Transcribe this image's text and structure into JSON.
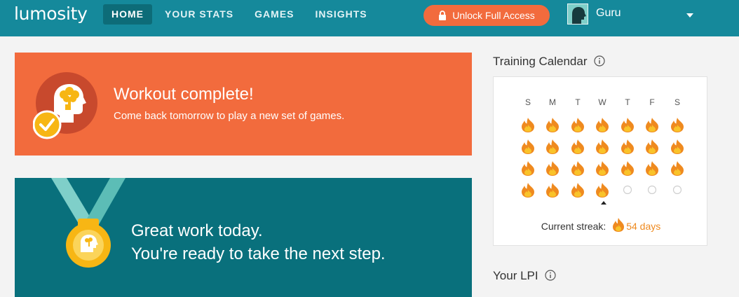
{
  "app": {
    "logo_text": "lumosity"
  },
  "nav": {
    "items": [
      {
        "label": "HOME",
        "active": true
      },
      {
        "label": "YOUR STATS",
        "active": false
      },
      {
        "label": "GAMES",
        "active": false
      },
      {
        "label": "INSIGHTS",
        "active": false
      }
    ]
  },
  "header": {
    "unlock_label": "Unlock Full Access",
    "username": "Guru"
  },
  "workout_card": {
    "title": "Workout complete!",
    "subtitle": "Come back tomorrow to play a new set of games."
  },
  "great_work_card": {
    "line1": "Great work today.",
    "line2": "You're ready to take the next step."
  },
  "training_calendar": {
    "title": "Training Calendar",
    "weekdays": [
      "S",
      "M",
      "T",
      "W",
      "T",
      "F",
      "S"
    ],
    "weeks": [
      [
        "trained",
        "trained",
        "trained",
        "trained",
        "trained",
        "trained",
        "trained"
      ],
      [
        "trained",
        "trained",
        "trained",
        "trained",
        "trained",
        "trained",
        "trained"
      ],
      [
        "trained",
        "trained",
        "trained",
        "trained",
        "trained",
        "trained",
        "trained"
      ],
      [
        "trained",
        "trained",
        "trained",
        "trained",
        "empty",
        "empty",
        "empty"
      ]
    ],
    "today_index": {
      "week": 3,
      "day": 3
    },
    "streak_label": "Current streak:",
    "streak_value": "54 days"
  },
  "lpi": {
    "title": "Your LPI"
  },
  "colors": {
    "header_bg": "#15899b",
    "nav_active_bg": "#0d6c78",
    "accent_orange": "#f26b3d",
    "teal_card": "#09707c",
    "flame": "#ef8a1f",
    "gold": "#f7b614"
  }
}
